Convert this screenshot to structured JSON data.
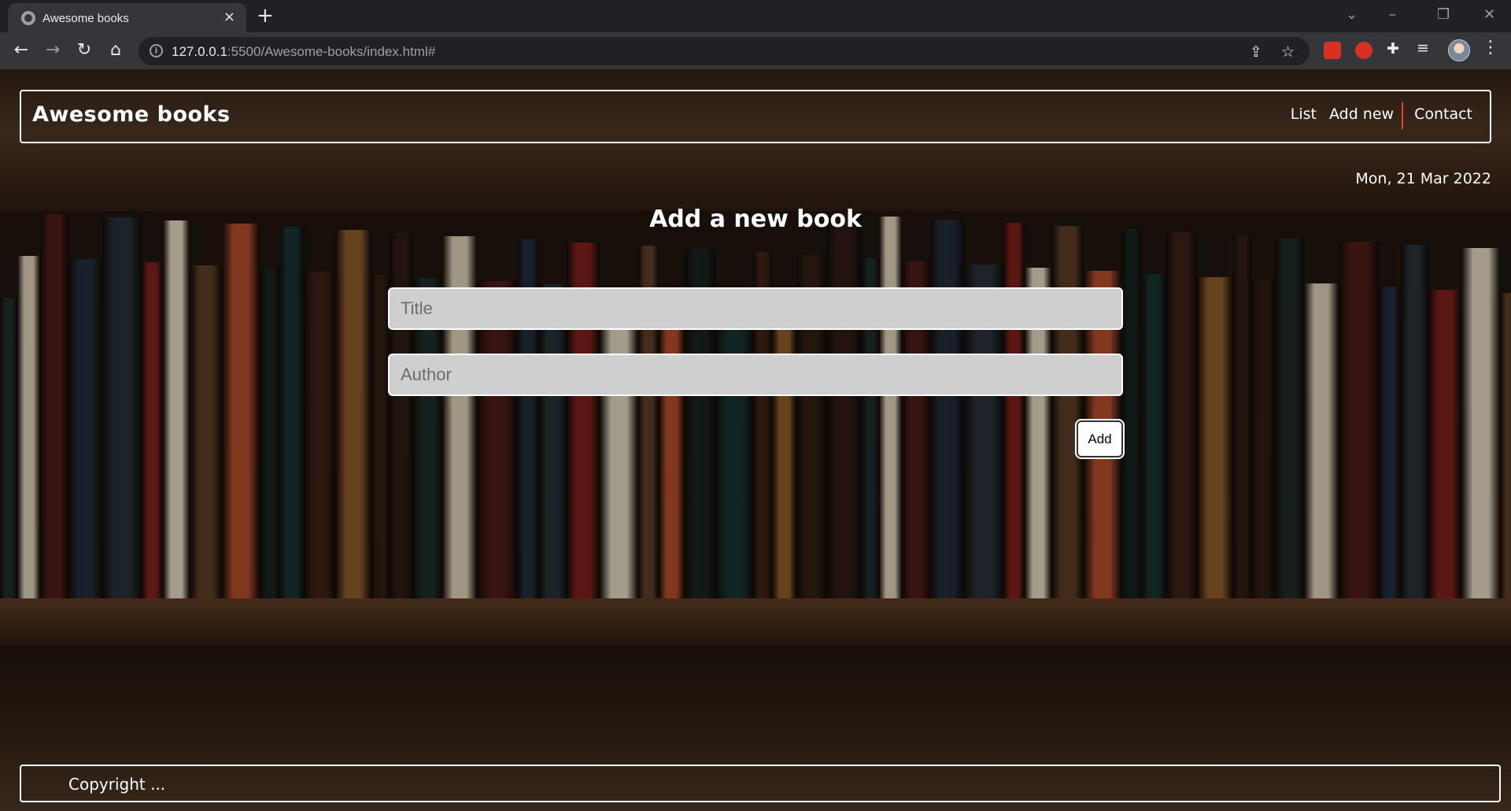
{
  "browser": {
    "tab_title": "Awesome books",
    "tab_close": "×",
    "new_tab": "+",
    "window_controls": [
      "⌄",
      "–",
      "❐",
      "✕"
    ],
    "url_host": "127.0.0.1",
    "url_path": ":5500/Awesome-books/index.html#",
    "nav_icons": [
      "back-icon",
      "forward-icon",
      "reload-icon",
      "home-icon"
    ],
    "nav_glyphs": [
      "←",
      "→",
      "↻",
      "⌂"
    ],
    "extension_colors": [
      "#d93025",
      "#d93025",
      "#e8eaed"
    ]
  },
  "page": {
    "brand": "Awesome books",
    "nav": {
      "list": "List",
      "add_new": "Add new",
      "contact": "Contact"
    },
    "date": "Mon, 21 Mar 2022",
    "heading": "Add a new book",
    "form": {
      "title_placeholder": "Title",
      "author_placeholder": "Author",
      "add_label": "Add"
    },
    "footer": "Copyright ..."
  },
  "colors": {
    "nav_separator": "#e3462b",
    "input_bg": "#cfcfcf"
  }
}
